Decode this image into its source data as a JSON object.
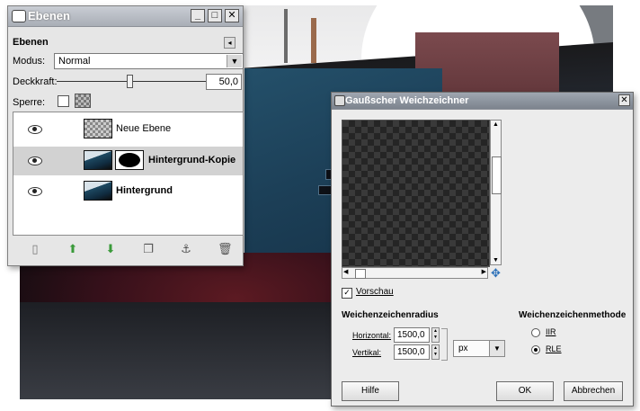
{
  "layers_window": {
    "title": "Ebenen",
    "dock_title": "Ebenen",
    "mode_label": "Modus:",
    "mode_value": "Normal",
    "opacity_label": "Deckkraft:",
    "opacity_value": "50,0",
    "opacity_fraction": 0.5,
    "lock_label": "Sperre:",
    "layers": [
      {
        "name": "Neue Ebene",
        "bold": false
      },
      {
        "name": "Hintergrund-Kopie",
        "bold": true
      },
      {
        "name": "Hintergrund",
        "bold": true
      }
    ],
    "toolbar_icons": [
      "new-layer-icon",
      "raise-layer-icon",
      "lower-layer-icon",
      "duplicate-layer-icon",
      "anchor-layer-icon",
      "delete-layer-icon"
    ]
  },
  "blur_dialog": {
    "title": "Gaußscher Weichzeichner",
    "preview_label": "Vorschau",
    "preview_checked": true,
    "radius_title": "Weichenzeichenradius",
    "horizontal_label": "Horizontal:",
    "horizontal_value": "1500,0",
    "vertical_label": "Vertikal:",
    "vertical_value": "1500,0",
    "unit_value": "px",
    "method_title": "Weichenzeichenmethode",
    "methods": [
      {
        "label": "IIR",
        "selected": false
      },
      {
        "label": "RLE",
        "selected": true
      }
    ],
    "help_button": "Hilfe",
    "ok_button": "OK",
    "cancel_button": "Abbrechen"
  }
}
